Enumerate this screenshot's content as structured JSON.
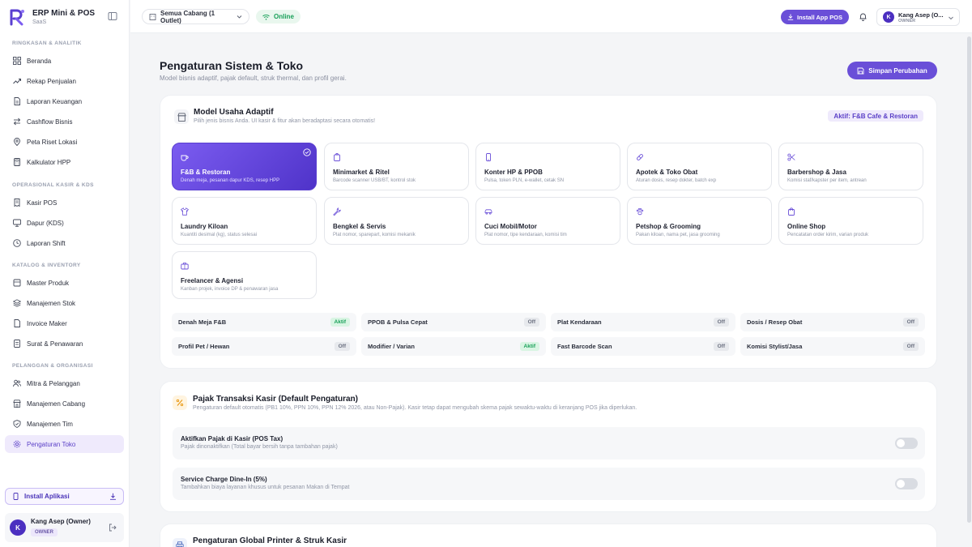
{
  "brand": {
    "name": "ERP Mini & POS",
    "sub": "SaaS"
  },
  "sidebar": {
    "sections": [
      {
        "title": "RINGKASAN & ANALITIK",
        "items": [
          "Beranda",
          "Rekap Penjualan",
          "Laporan Keuangan",
          "Cashflow Bisnis",
          "Peta Riset Lokasi",
          "Kalkulator HPP"
        ]
      },
      {
        "title": "OPERASIONAL KASIR & KDS",
        "items": [
          "Kasir POS",
          "Dapur (KDS)",
          "Laporan Shift"
        ]
      },
      {
        "title": "KATALOG & INVENTORY",
        "items": [
          "Master Produk",
          "Manajemen Stok",
          "Invoice Maker",
          "Surat & Penawaran"
        ]
      },
      {
        "title": "PELANGGAN & ORGANISASI",
        "items": [
          "Mitra & Pelanggan",
          "Manajemen Cabang",
          "Manajemen Tim",
          "Pengaturan Toko"
        ]
      }
    ],
    "install_label": "Install Aplikasi",
    "user": {
      "initial": "K",
      "name": "Kang Asep (Owner)",
      "role": "OWNER"
    }
  },
  "topbar": {
    "branch": "Semua Cabang (1 Outlet)",
    "status": "Online",
    "install_label": "Install App POS",
    "user": {
      "initial": "K",
      "name": "Kang Asep (Owner)",
      "display_name": "Kang Asep (O...",
      "role": "OWNER"
    }
  },
  "page": {
    "title": "Pengaturan Sistem & Toko",
    "subtitle": "Model bisnis adaptif, pajak default, struk thermal, dan profil gerai.",
    "save_label": "Simpan Perubahan"
  },
  "business_model": {
    "title": "Model Usaha Adaptif",
    "subtitle": "Pilih jenis bisnis Anda. UI kasir & fitur akan beradaptasi secara otomatis!",
    "active_badge": "Aktif: F&B Cafe & Restoran",
    "types": [
      {
        "name": "F&B & Restoran",
        "desc": "Denah meja, pesanan dapur KDS, resep HPP",
        "icon": "coffee-icon",
        "selected": true
      },
      {
        "name": "Minimarket & Ritel",
        "desc": "Barcode scanner USB/BT, kontrol stok",
        "icon": "basket-icon",
        "selected": false
      },
      {
        "name": "Konter HP & PPOB",
        "desc": "Pulsa, token PLN, e-wallet, cetak SN",
        "icon": "smartphone-icon",
        "selected": false
      },
      {
        "name": "Apotek & Toko Obat",
        "desc": "Aturan dosis, resep dokter, batch exp",
        "icon": "pill-icon",
        "selected": false
      },
      {
        "name": "Barbershop & Jasa",
        "desc": "Komisi staf/kapster per item, antrean",
        "icon": "scissors-icon",
        "selected": false
      },
      {
        "name": "Laundry Kiloan",
        "desc": "Kuantiti desimal (kg), status selesai",
        "icon": "shirt-icon",
        "selected": false
      },
      {
        "name": "Bengkel & Servis",
        "desc": "Plat nomor, sparepart, komisi mekanik",
        "icon": "wrench-icon",
        "selected": false
      },
      {
        "name": "Cuci Mobil/Motor",
        "desc": "Plat nomor, tipe kendaraan, komisi tim",
        "icon": "car-icon",
        "selected": false
      },
      {
        "name": "Petshop & Grooming",
        "desc": "Pakan kiloan, nama pet, jasa grooming",
        "icon": "paw-icon",
        "selected": false
      },
      {
        "name": "Online Shop",
        "desc": "Pencatatan order kirim, varian produk",
        "icon": "shopping-bag-icon",
        "selected": false
      },
      {
        "name": "Freelancer & Agensi",
        "desc": "Kanban projek, invoice DP & penawaran jasa",
        "icon": "briefcase-icon",
        "selected": false
      }
    ],
    "features": [
      {
        "name": "Denah Meja F&B",
        "state": "Aktif"
      },
      {
        "name": "PPOB & Pulsa Cepat",
        "state": "Off"
      },
      {
        "name": "Plat Kendaraan",
        "state": "Off"
      },
      {
        "name": "Dosis / Resep Obat",
        "state": "Off"
      },
      {
        "name": "Profil Pet / Hewan",
        "state": "Off"
      },
      {
        "name": "Modifier / Varian",
        "state": "Aktif"
      },
      {
        "name": "Fast Barcode Scan",
        "state": "Off"
      },
      {
        "name": "Komisi Stylist/Jasa",
        "state": "Off"
      }
    ]
  },
  "tax": {
    "title": "Pajak Transaksi Kasir (Default Pengaturan)",
    "subtitle": "Pengaturan default otomatis (PB1 10%, PPN 10%, PPN 12% 2026, atau Non-Pajak). Kasir tetap dapat mengubah skema pajak sewaktu-waktu di keranjang POS jika diperlukan.",
    "rows": [
      {
        "name": "Aktifkan Pajak di Kasir (POS Tax)",
        "desc": "Pajak dinonaktifkan (Total bayar bersih tanpa tambahan pajak)",
        "enabled": false
      },
      {
        "name": "Service Charge Dine-In (5%)",
        "desc": "Tambahkan biaya layanan khusus untuk pesanan Makan di Tempat",
        "enabled": false
      }
    ]
  },
  "printer": {
    "title": "Pengaturan Global Printer & Struk Kasir"
  },
  "colors": {
    "accent": "#6a4fd8",
    "accent_dark": "#4f33c9",
    "success": "#18a058",
    "active_bg": "#efeafc"
  }
}
